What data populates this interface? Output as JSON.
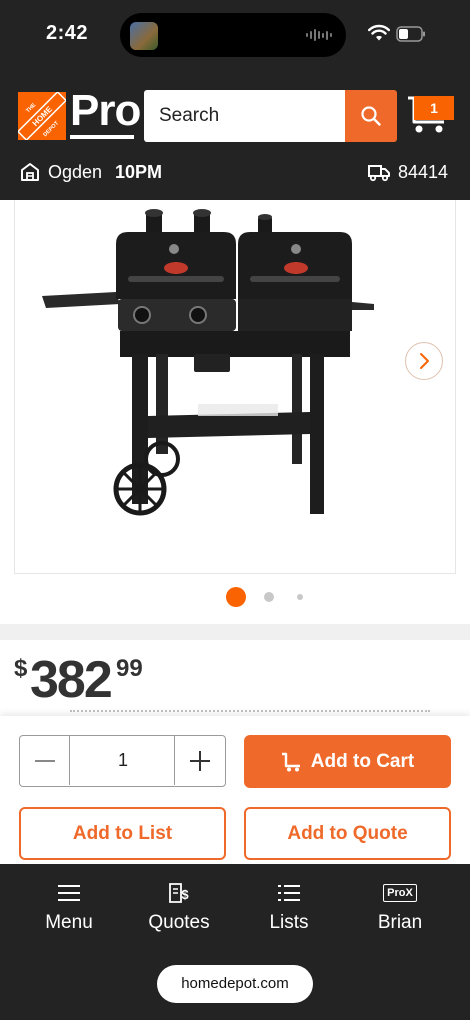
{
  "status_bar": {
    "time": "2:42"
  },
  "header": {
    "logo_text": "THE HOME DEPOT",
    "pro_label": "Pro",
    "search_placeholder": "Search",
    "cart_count": "1",
    "store": {
      "name": "Ogden",
      "hours": "10PM"
    },
    "delivery_zip": "84414"
  },
  "gallery": {
    "image_name": "dual-fuel-grill",
    "dot_count": 3,
    "active_dot": 1
  },
  "price": {
    "currency": "$",
    "dollars": "382",
    "cents": "99"
  },
  "actions": {
    "quantity": "1",
    "add_to_cart": "Add to Cart",
    "add_to_list": "Add to List",
    "add_to_quote": "Add to Quote"
  },
  "bottom_nav": {
    "items": [
      {
        "label": "Menu",
        "icon": "menu-icon"
      },
      {
        "label": "Quotes",
        "icon": "quotes-icon"
      },
      {
        "label": "Lists",
        "icon": "lists-icon"
      },
      {
        "label": "Brian",
        "icon": "prox-icon"
      }
    ],
    "prox_badge": "ProX"
  },
  "browser": {
    "url": "homedepot.com"
  },
  "colors": {
    "brand_orange": "#f96302",
    "button_orange": "#ef6a2a",
    "dark_bg": "#232323"
  }
}
